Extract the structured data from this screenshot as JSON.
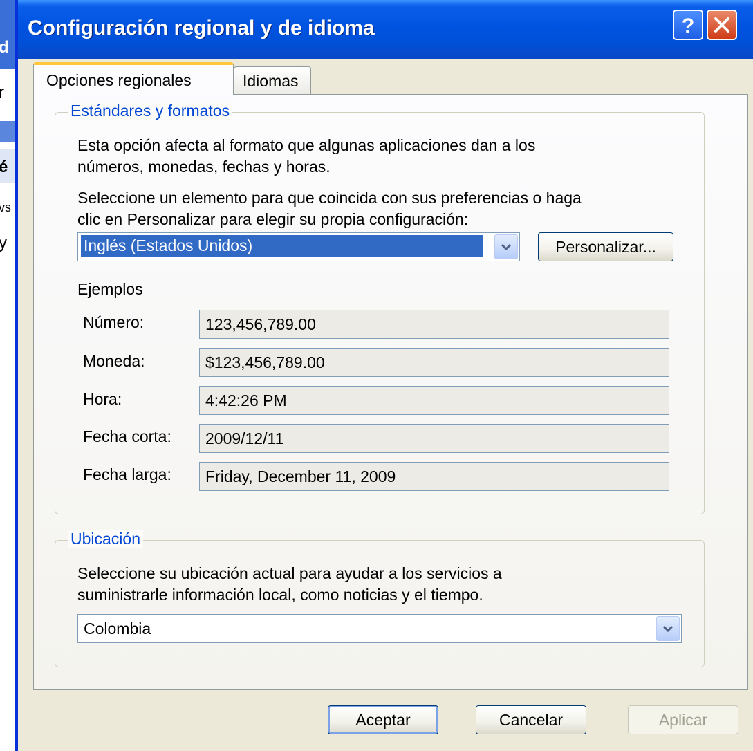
{
  "background_window": {
    "fragments": [
      "d",
      "r",
      "é",
      "vs",
      "y"
    ]
  },
  "window": {
    "title": "Configuración regional y de idioma",
    "help_icon": "question-mark-icon",
    "close_icon": "close-x-icon"
  },
  "tabs": [
    {
      "label": "Opciones regionales",
      "active": true
    },
    {
      "label": "Idiomas",
      "active": false
    }
  ],
  "standards": {
    "group_title": "Estándares y formatos",
    "description_line1": "Esta opción afecta al formato que algunas aplicaciones dan a los",
    "description_line2": "números, monedas, fechas y horas.",
    "instruction_line1": "Seleccione un elemento para que coincida con sus preferencias o haga",
    "instruction_line2": "clic en Personalizar para elegir su propia configuración:",
    "format_selected": "Inglés (Estados Unidos)",
    "customize_label": "Personalizar...",
    "examples_title": "Ejemplos",
    "examples": [
      {
        "label": "Número:",
        "value": "123,456,789.00"
      },
      {
        "label": "Moneda:",
        "value": "$123,456,789.00"
      },
      {
        "label": "Hora:",
        "value": "4:42:26 PM"
      },
      {
        "label": "Fecha corta:",
        "value": "2009/12/11"
      },
      {
        "label": "Fecha larga:",
        "value": "Friday, December 11, 2009"
      }
    ]
  },
  "location": {
    "group_title": "Ubicación",
    "description_line1": "Seleccione su ubicación actual para ayudar a los servicios a",
    "description_line2": "suministrarle información local, como noticias y el tiempo.",
    "selected": "Colombia"
  },
  "footer": {
    "ok_label": "Aceptar",
    "cancel_label": "Cancelar",
    "apply_label": "Aplicar"
  },
  "colors": {
    "titlebar": "#0053e0",
    "group_title": "#0046d5",
    "selection": "#316ac5",
    "tab_highlight": "#ffc83c"
  }
}
